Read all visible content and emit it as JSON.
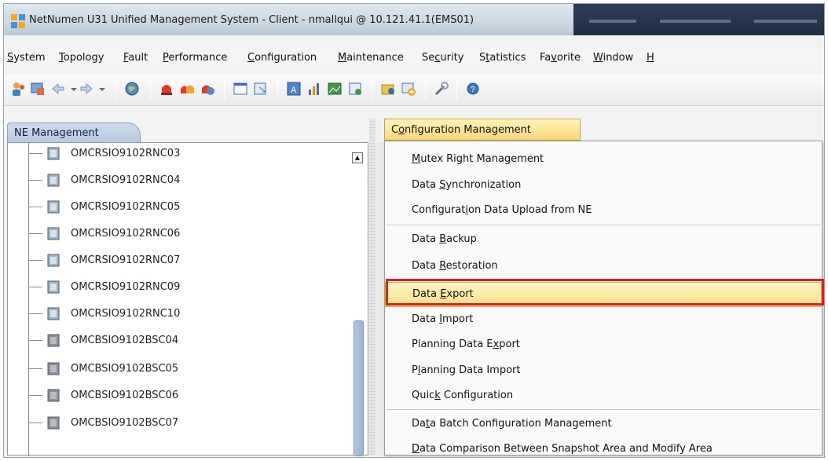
{
  "window": {
    "title": "NetNumen U31 Unified Management System - Client - nmallqui @ 10.121.41.1(EMS01)"
  },
  "menubar": {
    "items": [
      {
        "label": "System",
        "u": "S"
      },
      {
        "label": "Topology",
        "u": "T"
      },
      {
        "label": "Fault",
        "u": "F"
      },
      {
        "label": "Performance",
        "u": "P"
      },
      {
        "label": "Configuration",
        "u": "C"
      },
      {
        "label": "Maintenance",
        "u": "M"
      },
      {
        "label": "Security",
        "u": "c"
      },
      {
        "label": "Statistics",
        "u": "t"
      },
      {
        "label": "Favorite",
        "u": "v"
      },
      {
        "label": "Window",
        "u": "W"
      },
      {
        "label": "H",
        "u": "H"
      }
    ]
  },
  "toolbar": {
    "icons": [
      "users-icon",
      "window-icon",
      "back-arrow-icon",
      "dropdown-icon",
      "forward-arrow-icon",
      "dropdown-icon",
      "globe-icon",
      "alarm-red-icon",
      "alarm-multi-icon",
      "alarm-globe-icon",
      "table-icon",
      "export-icon",
      "text-icon",
      "chart-icon",
      "image-icon",
      "chart-add-icon",
      "folder-user-icon",
      "window-add-icon",
      "tools-icon",
      "help-icon"
    ]
  },
  "left_panel": {
    "tab_label": "NE Management",
    "tree_items": [
      {
        "label": "OMCRSIO9102RNC03",
        "type": "rnc"
      },
      {
        "label": "OMCRSIO9102RNC04",
        "type": "rnc"
      },
      {
        "label": "OMCRSIO9102RNC05",
        "type": "rnc"
      },
      {
        "label": "OMCRSIO9102RNC06",
        "type": "rnc"
      },
      {
        "label": "OMCRSIO9102RNC07",
        "type": "rnc"
      },
      {
        "label": "OMCRSIO9102RNC09",
        "type": "rnc"
      },
      {
        "label": "OMCRSIO9102RNC10",
        "type": "rnc"
      },
      {
        "label": "OMCBSIO9102BSC04",
        "type": "bsc"
      },
      {
        "label": "OMCBSIO9102BSC05",
        "type": "bsc"
      },
      {
        "label": "OMCBSIO9102BSC06",
        "type": "bsc"
      },
      {
        "label": "OMCBSIO9102BSC07",
        "type": "bsc"
      }
    ]
  },
  "config_menu": {
    "header": "Configuration Management",
    "header_u": "o",
    "items": [
      {
        "label": "Mutex Right Management",
        "u_index": 0
      },
      {
        "label": "Data Synchronization",
        "u_index": 5
      },
      {
        "label": "Configuration Data Upload from NE",
        "u_index": 10
      },
      {
        "label": "Data Backup",
        "u_index": 5,
        "sep_before": true
      },
      {
        "label": "Data Restoration",
        "u_index": 5
      },
      {
        "label": "Data Export",
        "u_index": 5,
        "sep_before": true,
        "selected": true
      },
      {
        "label": "Data Import",
        "u_index": 5
      },
      {
        "label": "Planning Data Export",
        "u_index": 15
      },
      {
        "label": "Planning Data Import",
        "u_index": 1
      },
      {
        "label": "Quick Configuration",
        "u_index": 4
      },
      {
        "label": "Data Batch Configuration Management",
        "u_index": 2,
        "sep_before": true
      },
      {
        "label": "Data Comparison Between Snapshot Area and Modify Area",
        "u_index": 0
      }
    ]
  },
  "colors": {
    "accent_highlight": "#dc1e1e",
    "selected_bg": "#fbe08a",
    "tab_bg": "#b6c8df"
  }
}
